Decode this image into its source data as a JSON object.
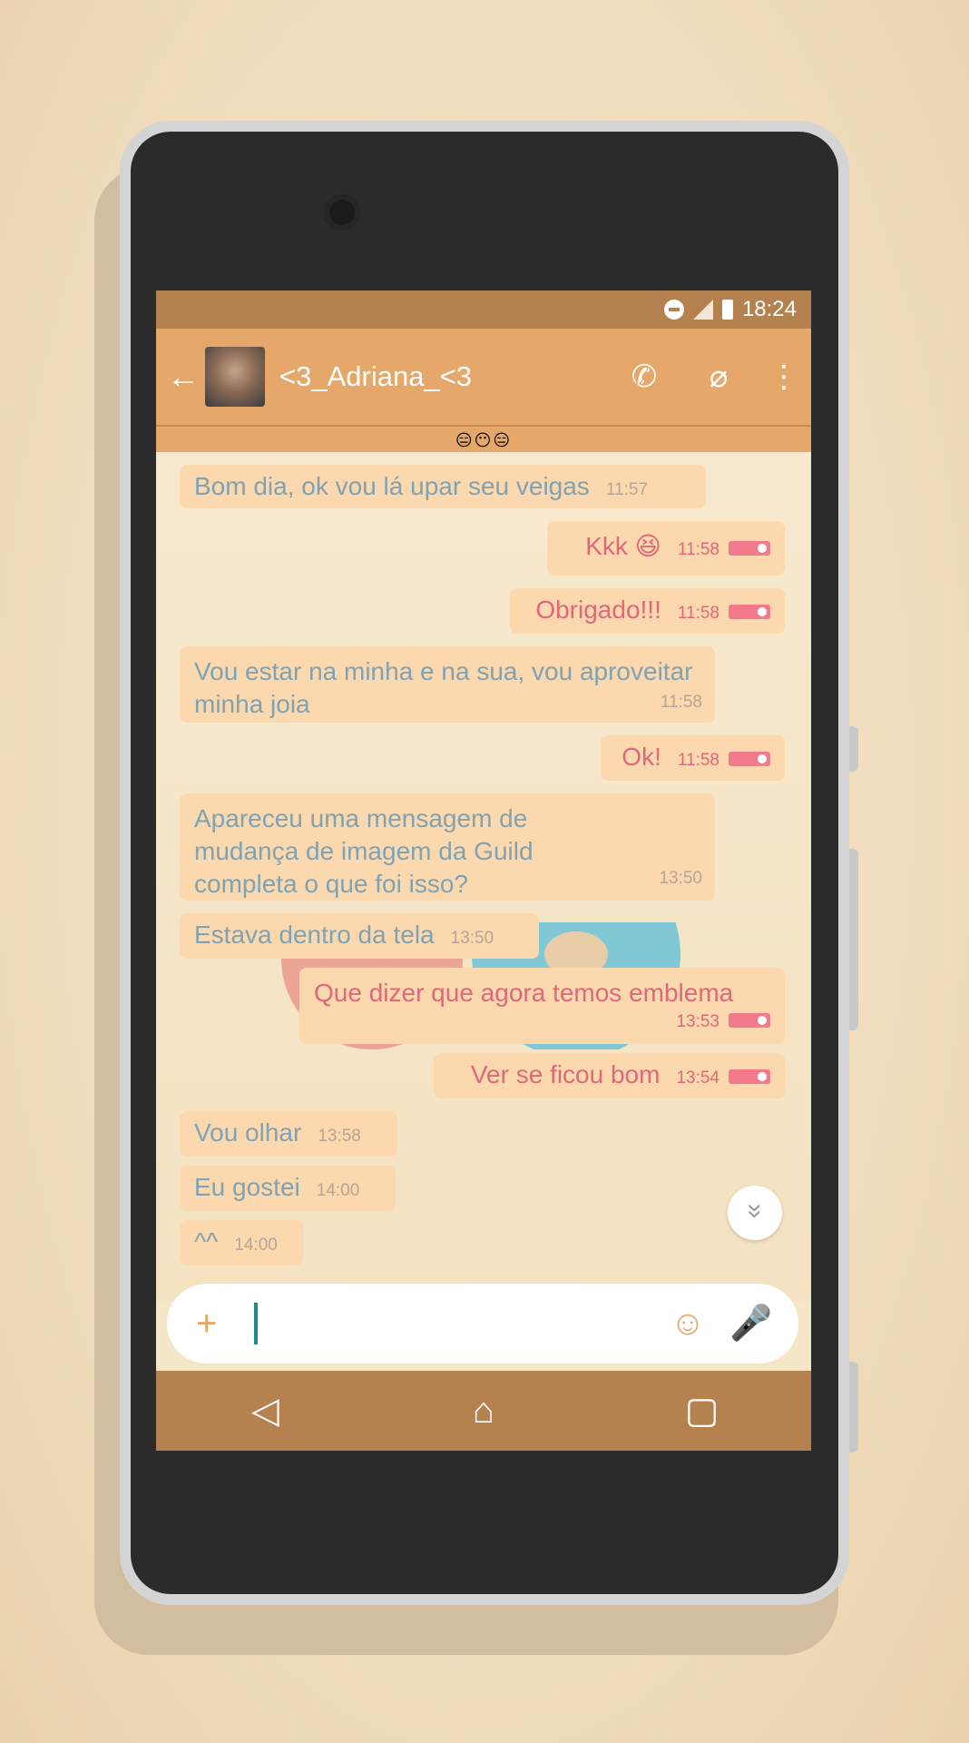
{
  "status_bar": {
    "time": "18:24"
  },
  "header": {
    "contact_name": "<3_Adriana_<3"
  },
  "status_strip": "😑😶😑",
  "messages": [
    {
      "side": "in",
      "text": "Bom dia, ok vou lá  upar seu veigas",
      "time": "11:57"
    },
    {
      "side": "out",
      "text": "Kkk 😆",
      "time": "11:58"
    },
    {
      "side": "out",
      "text": "Obrigado!!!",
      "time": "11:58"
    },
    {
      "side": "in",
      "text": "Vou estar na minha e na sua, vou aproveitar minha joia",
      "time": "11:58"
    },
    {
      "side": "out",
      "text": "Ok!",
      "time": "11:58"
    },
    {
      "side": "in",
      "text": "Apareceu uma mensagem de mudança de imagem da Guild completa o que foi isso?",
      "time": "13:50"
    },
    {
      "side": "in",
      "text": "Estava dentro da tela",
      "time": "13:50"
    },
    {
      "side": "out",
      "text": "Que dizer que agora temos emblema",
      "time": "13:53"
    },
    {
      "side": "out",
      "text": "Ver se ficou bom",
      "time": "13:54"
    },
    {
      "side": "in",
      "text": "Vou olhar",
      "time": "13:58"
    },
    {
      "side": "in",
      "text": "Eu gostei",
      "time": "14:00"
    },
    {
      "side": "in",
      "text": "^^",
      "time": "14:00"
    }
  ],
  "composer": {
    "placeholder": ""
  },
  "icons": {
    "back": "←",
    "call": "✆",
    "attach": "⌀",
    "menu": "⋮",
    "plus": "+",
    "emoji": "☺",
    "mic": "🎤",
    "scroll_down": "»",
    "nav_back": "◁",
    "nav_home": "⌂",
    "nav_recents": "▢"
  },
  "colors": {
    "appbar": "#e5a86a",
    "statusbar": "#b5814f",
    "bubble": "#fbd8ad",
    "incoming_text": "#7fa3b4",
    "outgoing_text": "#e0687a"
  }
}
